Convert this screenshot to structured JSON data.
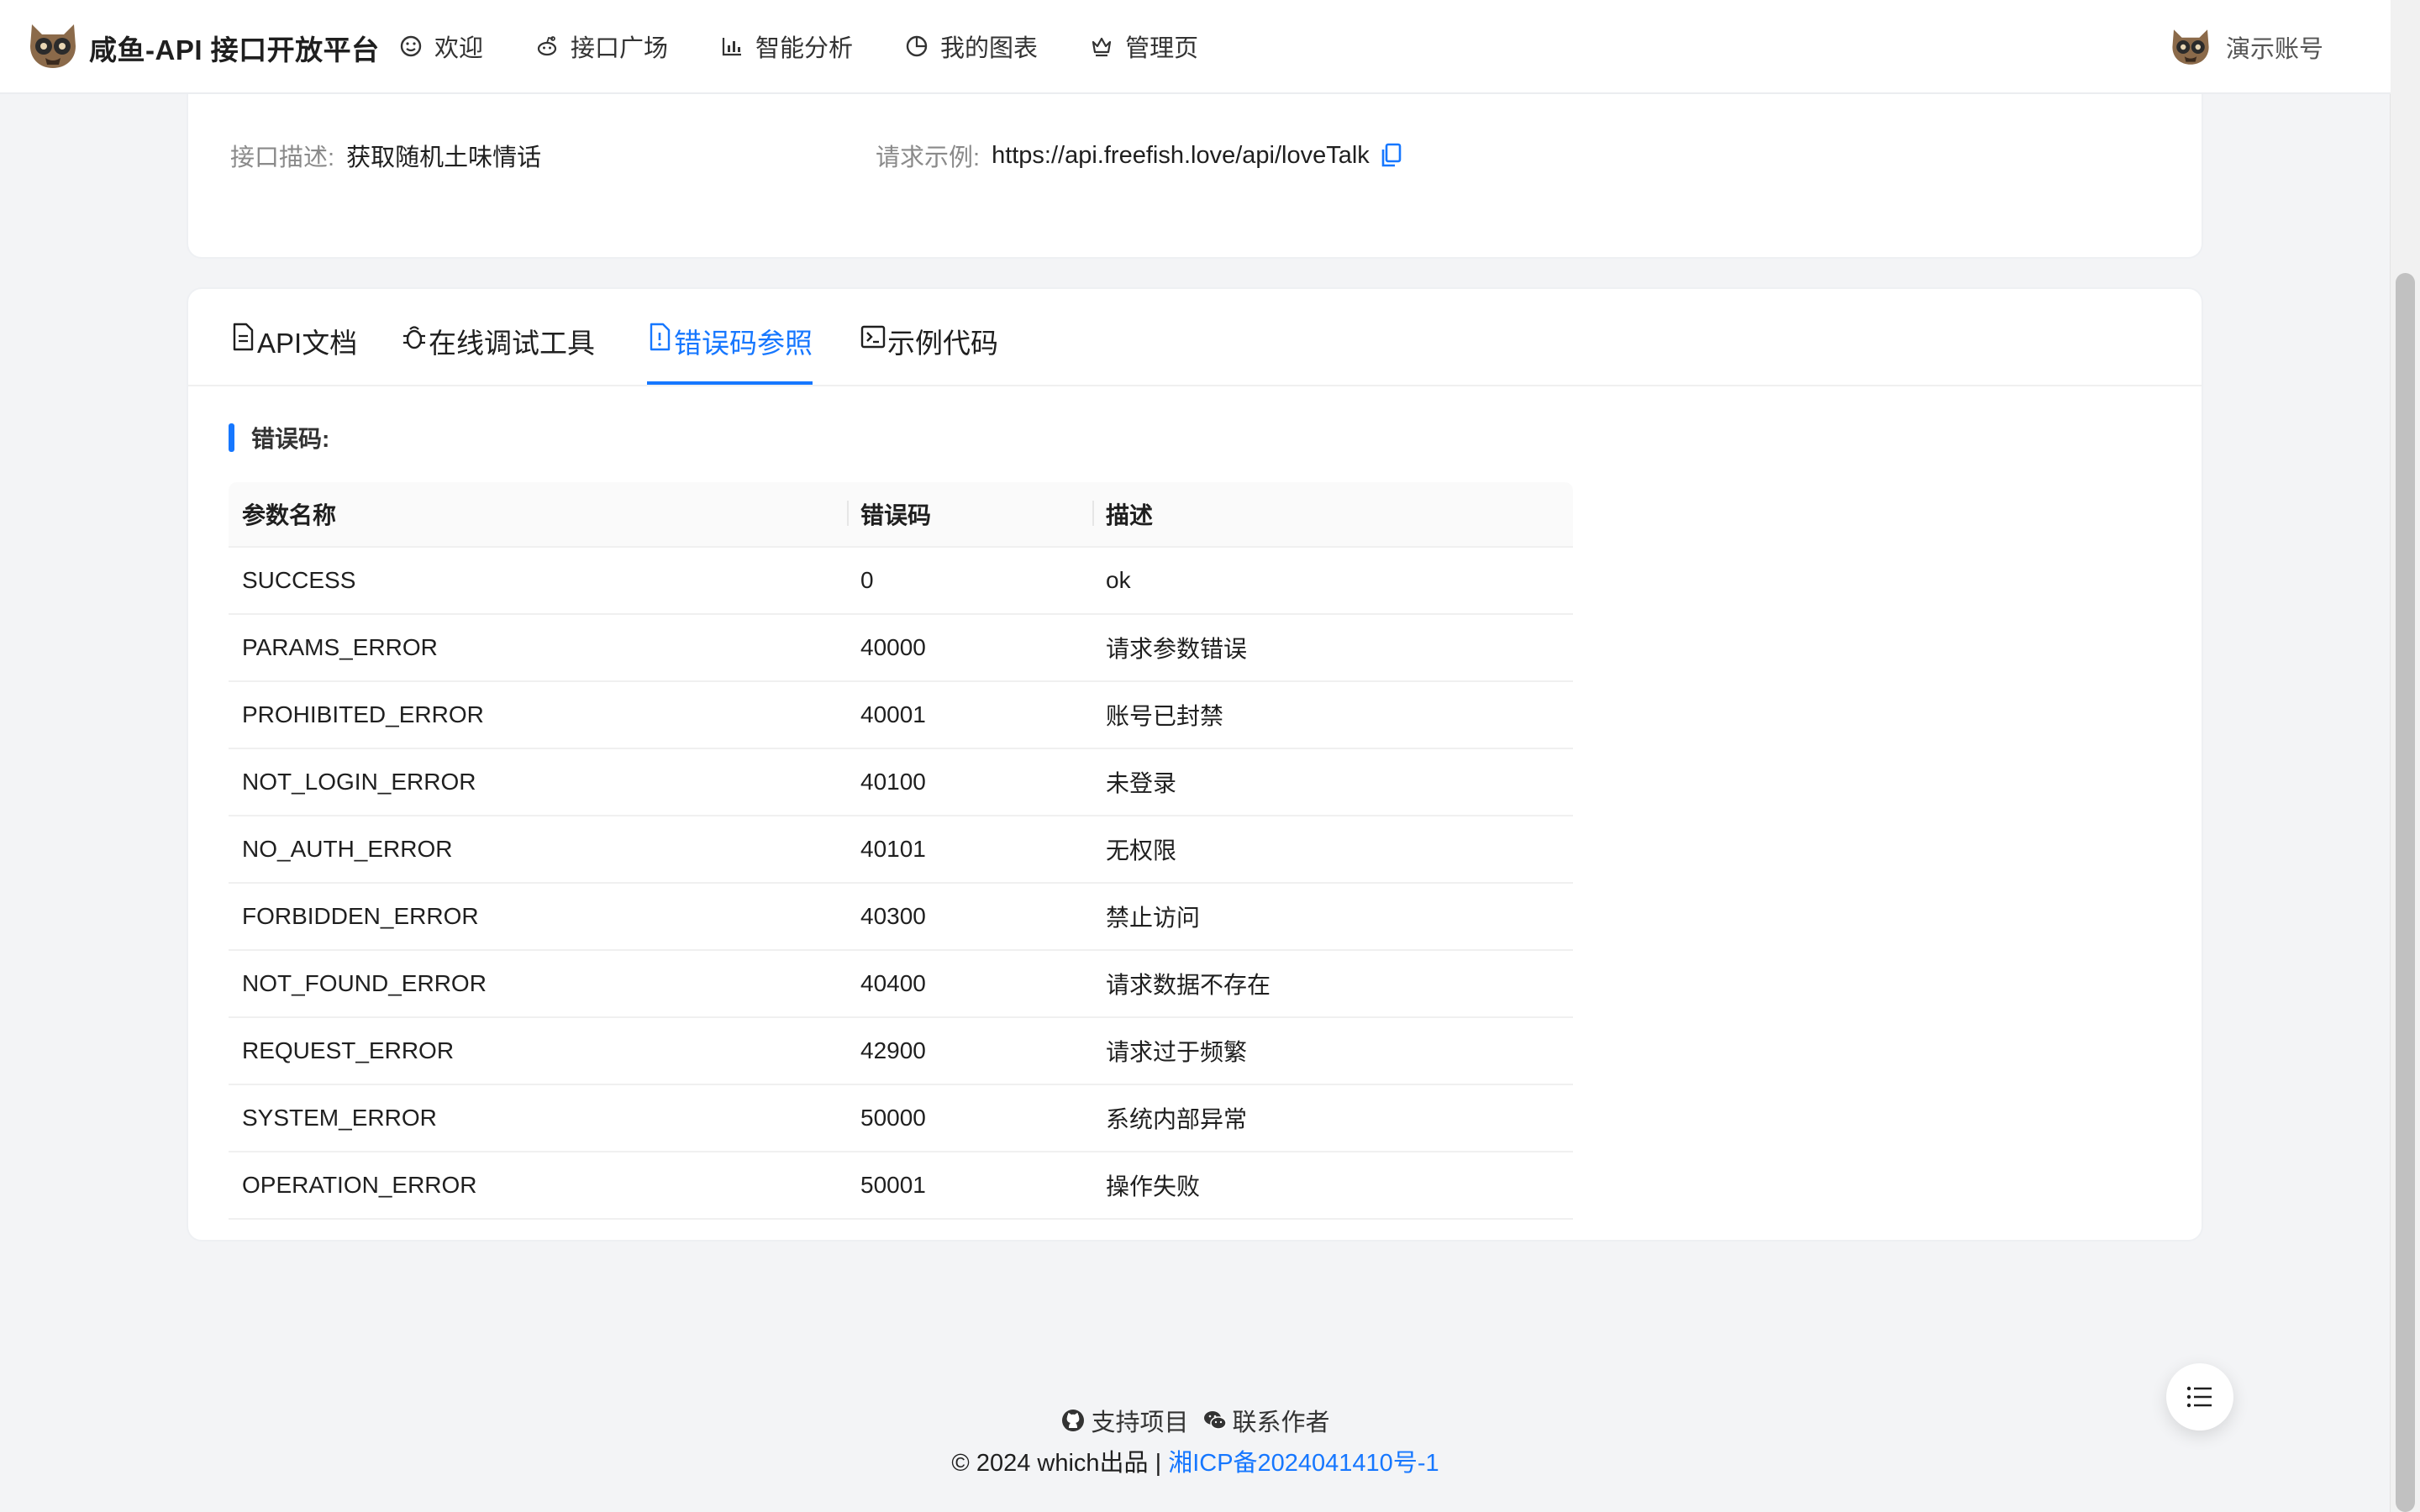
{
  "header": {
    "brand": "咸鱼-API 接口开放平台",
    "nav": [
      {
        "label": "欢迎",
        "icon": "smile-icon"
      },
      {
        "label": "接口广场",
        "icon": "reddit-icon"
      },
      {
        "label": "智能分析",
        "icon": "bar-chart-icon"
      },
      {
        "label": "我的图表",
        "icon": "pie-chart-icon"
      },
      {
        "label": "管理页",
        "icon": "crown-icon"
      }
    ],
    "user": "演示账号"
  },
  "info": {
    "desc_label": "接口描述:",
    "desc_value": "获取随机土味情话",
    "example_label": "请求示例:",
    "example_value": "https://api.freefish.love/api/loveTalk"
  },
  "tabs": [
    {
      "label": "API文档",
      "icon": "file-text-icon"
    },
    {
      "label": "在线调试工具",
      "icon": "bug-icon"
    },
    {
      "label": "错误码参照",
      "icon": "file-exclamation-icon",
      "active": true
    },
    {
      "label": "示例代码",
      "icon": "code-icon"
    }
  ],
  "section_title": "错误码:",
  "error_table": {
    "columns": [
      "参数名称",
      "错误码",
      "描述"
    ],
    "rows": [
      [
        "SUCCESS",
        "0",
        "ok"
      ],
      [
        "PARAMS_ERROR",
        "40000",
        "请求参数错误"
      ],
      [
        "PROHIBITED_ERROR",
        "40001",
        "账号已封禁"
      ],
      [
        "NOT_LOGIN_ERROR",
        "40100",
        "未登录"
      ],
      [
        "NO_AUTH_ERROR",
        "40101",
        "无权限"
      ],
      [
        "FORBIDDEN_ERROR",
        "40300",
        "禁止访问"
      ],
      [
        "NOT_FOUND_ERROR",
        "40400",
        "请求数据不存在"
      ],
      [
        "REQUEST_ERROR",
        "42900",
        "请求过于频繁"
      ],
      [
        "SYSTEM_ERROR",
        "50000",
        "系统内部异常"
      ],
      [
        "OPERATION_ERROR",
        "50001",
        "操作失败"
      ]
    ]
  },
  "footer": {
    "support": "支持项目",
    "contact": "联系作者",
    "copyright": "© 2024 which出品 |",
    "icp": "湘ICP备2024041410号-1"
  },
  "colors": {
    "accent": "#1677ff",
    "page_bg": "#f3f4f6",
    "card_bg": "#ffffff"
  }
}
